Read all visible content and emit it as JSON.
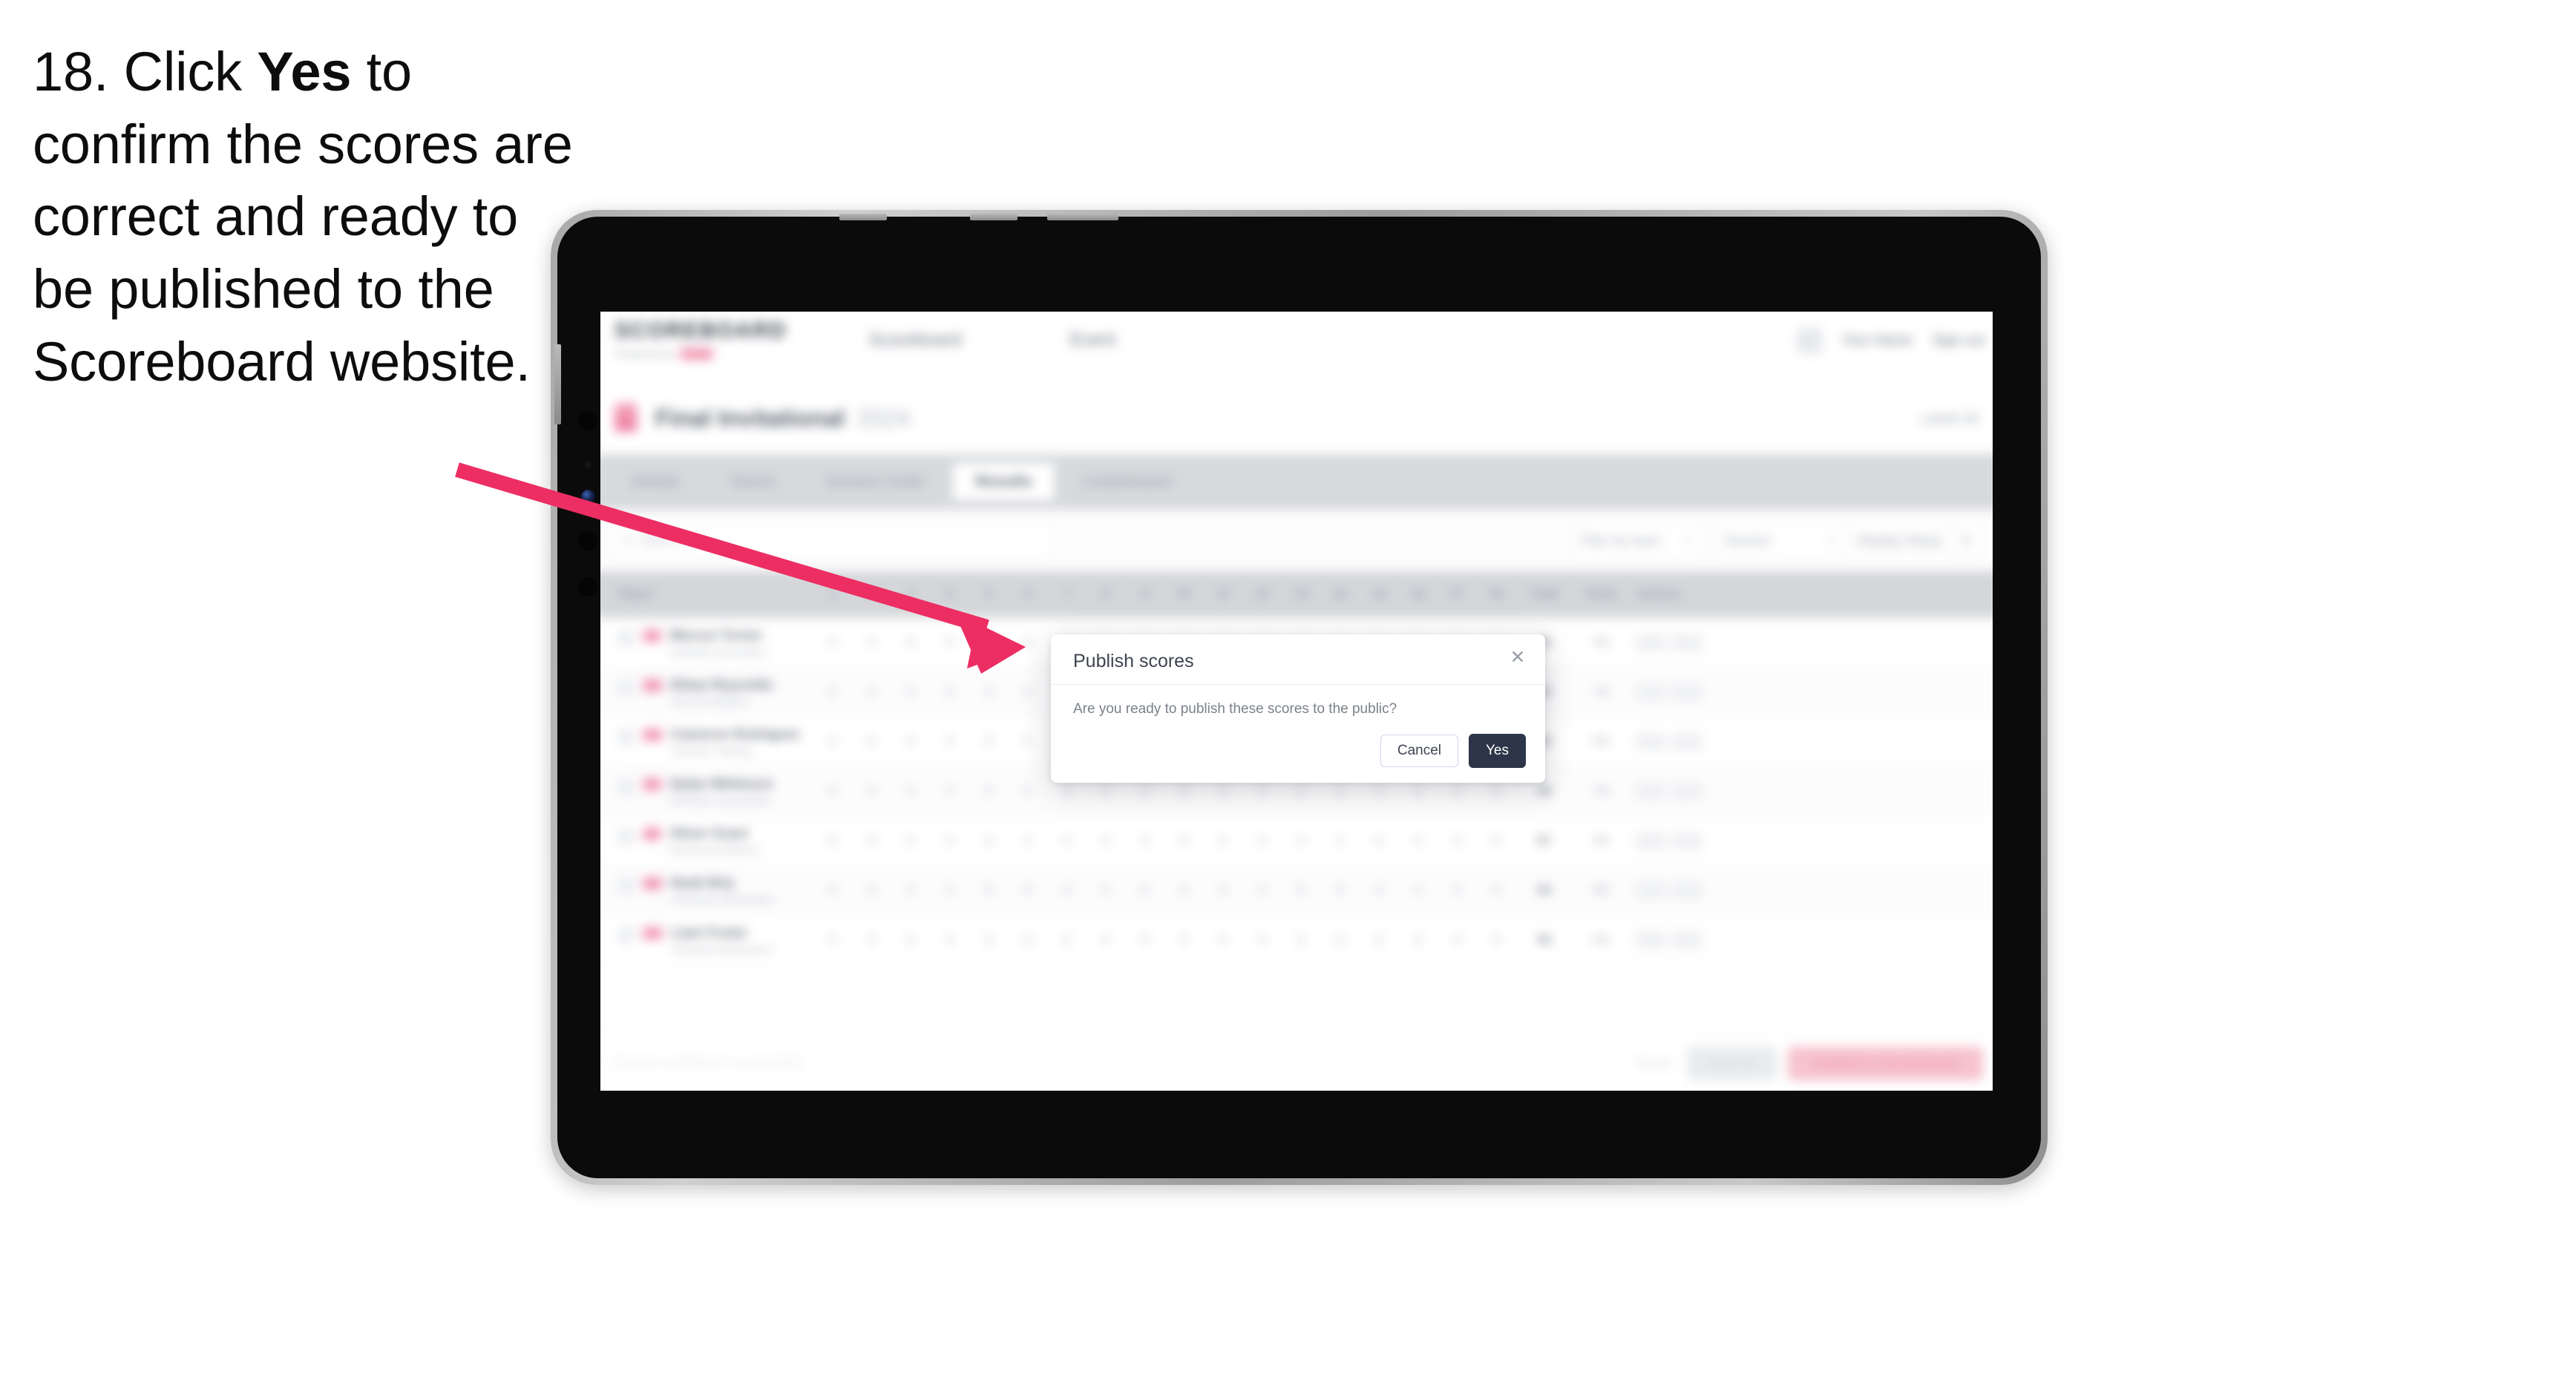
{
  "instruction": {
    "prefix": "18. Click ",
    "bold": "Yes",
    "suffix": " to confirm the scores are correct and ready to be published to the Scoreboard website."
  },
  "colors": {
    "arrow": "#ED2E63",
    "accent_pink": "#E0255F",
    "modal_primary": "#2C3648",
    "device_bezel": "#0B0B0B",
    "tab_bar": "#D7D9DD"
  },
  "device": {
    "type": "tablet",
    "orientation": "landscape"
  },
  "app": {
    "header": {
      "brand": "SCOREBOARD",
      "brand_sub": "Powered by",
      "brand_sub_pill": "ncaa",
      "nav": [
        {
          "label": "Scoreboard"
        },
        {
          "label": "Event"
        }
      ],
      "user_name": "Your Name",
      "sign_out": "Sign out"
    },
    "title_band": {
      "title": "Final Invitational",
      "year": "2024",
      "right_label": "Level 10"
    },
    "tabs": [
      {
        "label": "Details",
        "active": false
      },
      {
        "label": "Teams",
        "active": false
      },
      {
        "label": "Session Order",
        "active": false
      },
      {
        "label": "Results",
        "active": true
      },
      {
        "label": "Leaderboard",
        "active": false
      }
    ],
    "toolbar": {
      "search_placeholder": "Search",
      "filters": [
        {
          "label": "Filter by team"
        },
        {
          "label": "Session"
        }
      ],
      "link": "Display Setup",
      "icon": "settings-icon"
    },
    "table": {
      "columns": [
        "Player",
        "1",
        "2",
        "3",
        "4",
        "5",
        "6",
        "7",
        "8",
        "9",
        "10",
        "11",
        "12",
        "13",
        "14",
        "15",
        "16",
        "17",
        "18",
        "Total",
        "Place",
        "Actions"
      ],
      "rows": [
        {
          "badge": "JR",
          "name": "Marcus Turner",
          "club": "Eastside Gymnastics"
        },
        {
          "badge": "SR",
          "name": "Ethan Reynolds",
          "club": "Summit Athletics"
        },
        {
          "badge": "SO",
          "name": "Cameron Rodriguez",
          "club": "Pinnacle Training"
        },
        {
          "badge": "FR",
          "name": "Dylan Whitmore",
          "club": "Northstar Gymnastics"
        },
        {
          "badge": "JR",
          "name": "Oliver Grant",
          "club": "Riverbend Athletics"
        },
        {
          "badge": "SR",
          "name": "Noah Brly",
          "club": "Crestview Gymnastics"
        },
        {
          "badge": "SO",
          "name": "Liam Foster",
          "club": "Ironwood Gymnastics"
        }
      ]
    },
    "footer": {
      "note": "Results published successfully",
      "link": "Reset",
      "secondary_button": "Save all",
      "primary_button": "Publish to Scoreboard"
    }
  },
  "modal": {
    "title": "Publish scores",
    "message": "Are you ready to publish these scores to the public?",
    "close_icon": "close-icon",
    "cancel_label": "Cancel",
    "confirm_label": "Yes"
  }
}
